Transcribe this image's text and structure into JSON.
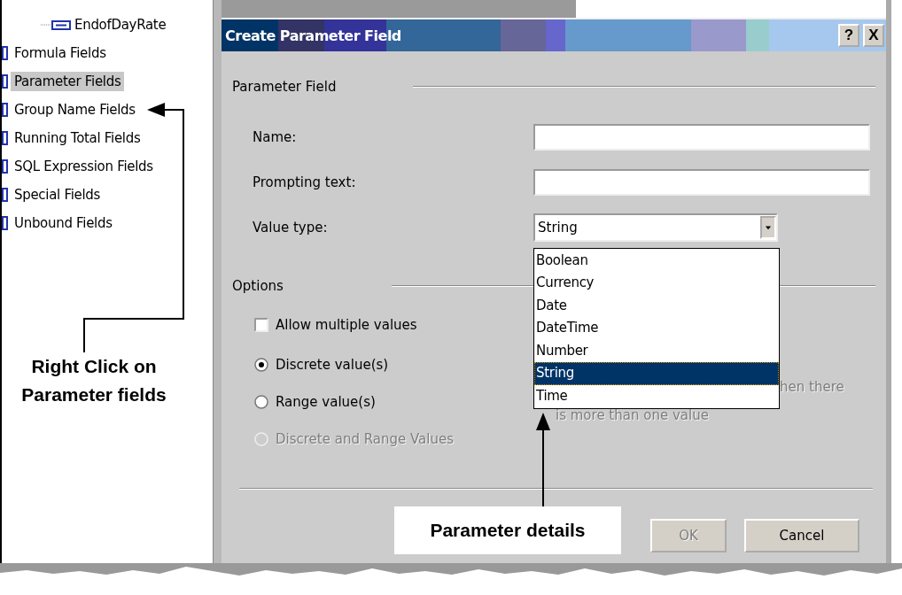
{
  "tree": {
    "items": [
      {
        "label": "EndofDayRate",
        "kind": "leaf",
        "selected": false
      },
      {
        "label": "Formula Fields",
        "kind": "category",
        "selected": false
      },
      {
        "label": "Parameter Fields",
        "kind": "category",
        "selected": true
      },
      {
        "label": "Group Name Fields",
        "kind": "category",
        "selected": false
      },
      {
        "label": "Running Total Fields",
        "kind": "category",
        "selected": false
      },
      {
        "label": "SQL Expression Fields",
        "kind": "category",
        "selected": false
      },
      {
        "label": "Special Fields",
        "kind": "category",
        "selected": false
      },
      {
        "label": "Unbound Fields",
        "kind": "category",
        "selected": false
      }
    ]
  },
  "callout_left": "Right Click on Parameter fields",
  "dialog": {
    "title": "Create Parameter Field",
    "help_button": "?",
    "close_button": "X",
    "parameter_section": "Parameter Field",
    "fields": [
      {
        "label": "Name:"
      },
      {
        "label": "Prompting text:"
      }
    ],
    "value_type": {
      "label": "Value type:",
      "value": "String",
      "expanded": true,
      "options": [
        {
          "label": "Boolean",
          "selected": false
        },
        {
          "label": "Currency",
          "selected": false
        },
        {
          "label": "Date",
          "selected": false
        },
        {
          "label": "DateTime",
          "selected": false
        },
        {
          "label": "Number",
          "selected": false
        },
        {
          "label": "String",
          "selected": true
        },
        {
          "label": "Time",
          "selected": false
        }
      ]
    },
    "options_section": "Options",
    "allow_multiple": {
      "label": "Allow multiple values",
      "checked": false
    },
    "radios": [
      {
        "label": "Discrete value(s)",
        "selected": true,
        "disabled": false
      },
      {
        "label": "Range value(s)",
        "selected": false,
        "disabled": false
      },
      {
        "label": "Discrete and Range Values",
        "selected": false,
        "disabled": true
      }
    ],
    "covered_note": [
      "hen there",
      "is more than one value"
    ],
    "buttons": [
      {
        "label": "OK",
        "disabled": true
      },
      {
        "label": "Cancel",
        "disabled": false
      }
    ]
  },
  "callout_bottom": "Parameter details"
}
